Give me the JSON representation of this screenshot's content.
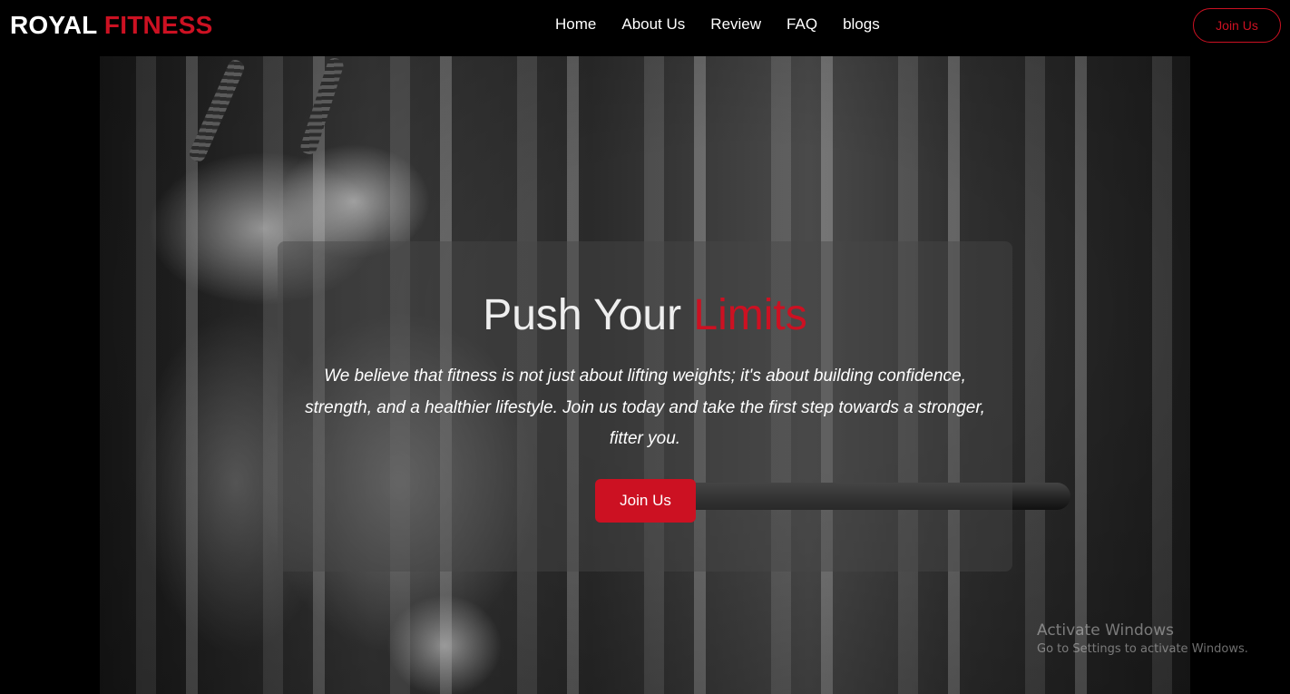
{
  "brand": {
    "part1": "ROYAL",
    "part2": "FITNESS"
  },
  "nav": {
    "links": [
      {
        "label": "Home"
      },
      {
        "label": "About Us"
      },
      {
        "label": "Review"
      },
      {
        "label": "FAQ"
      },
      {
        "label": "blogs"
      }
    ],
    "join_label": "Join Us"
  },
  "hero": {
    "title_plain": "Push Your",
    "title_accent": "Limits",
    "text": "We believe that fitness is not just about lifting weights; it's about building confidence, strength, and a healthier lifestyle. Join us today and take the first step towards a stronger, fitter you.",
    "cta_label": "Join Us"
  },
  "watermark": {
    "title": "Activate Windows",
    "subtitle": "Go to Settings to activate Windows."
  },
  "colors": {
    "accent": "#cc1122",
    "background": "#000000"
  }
}
